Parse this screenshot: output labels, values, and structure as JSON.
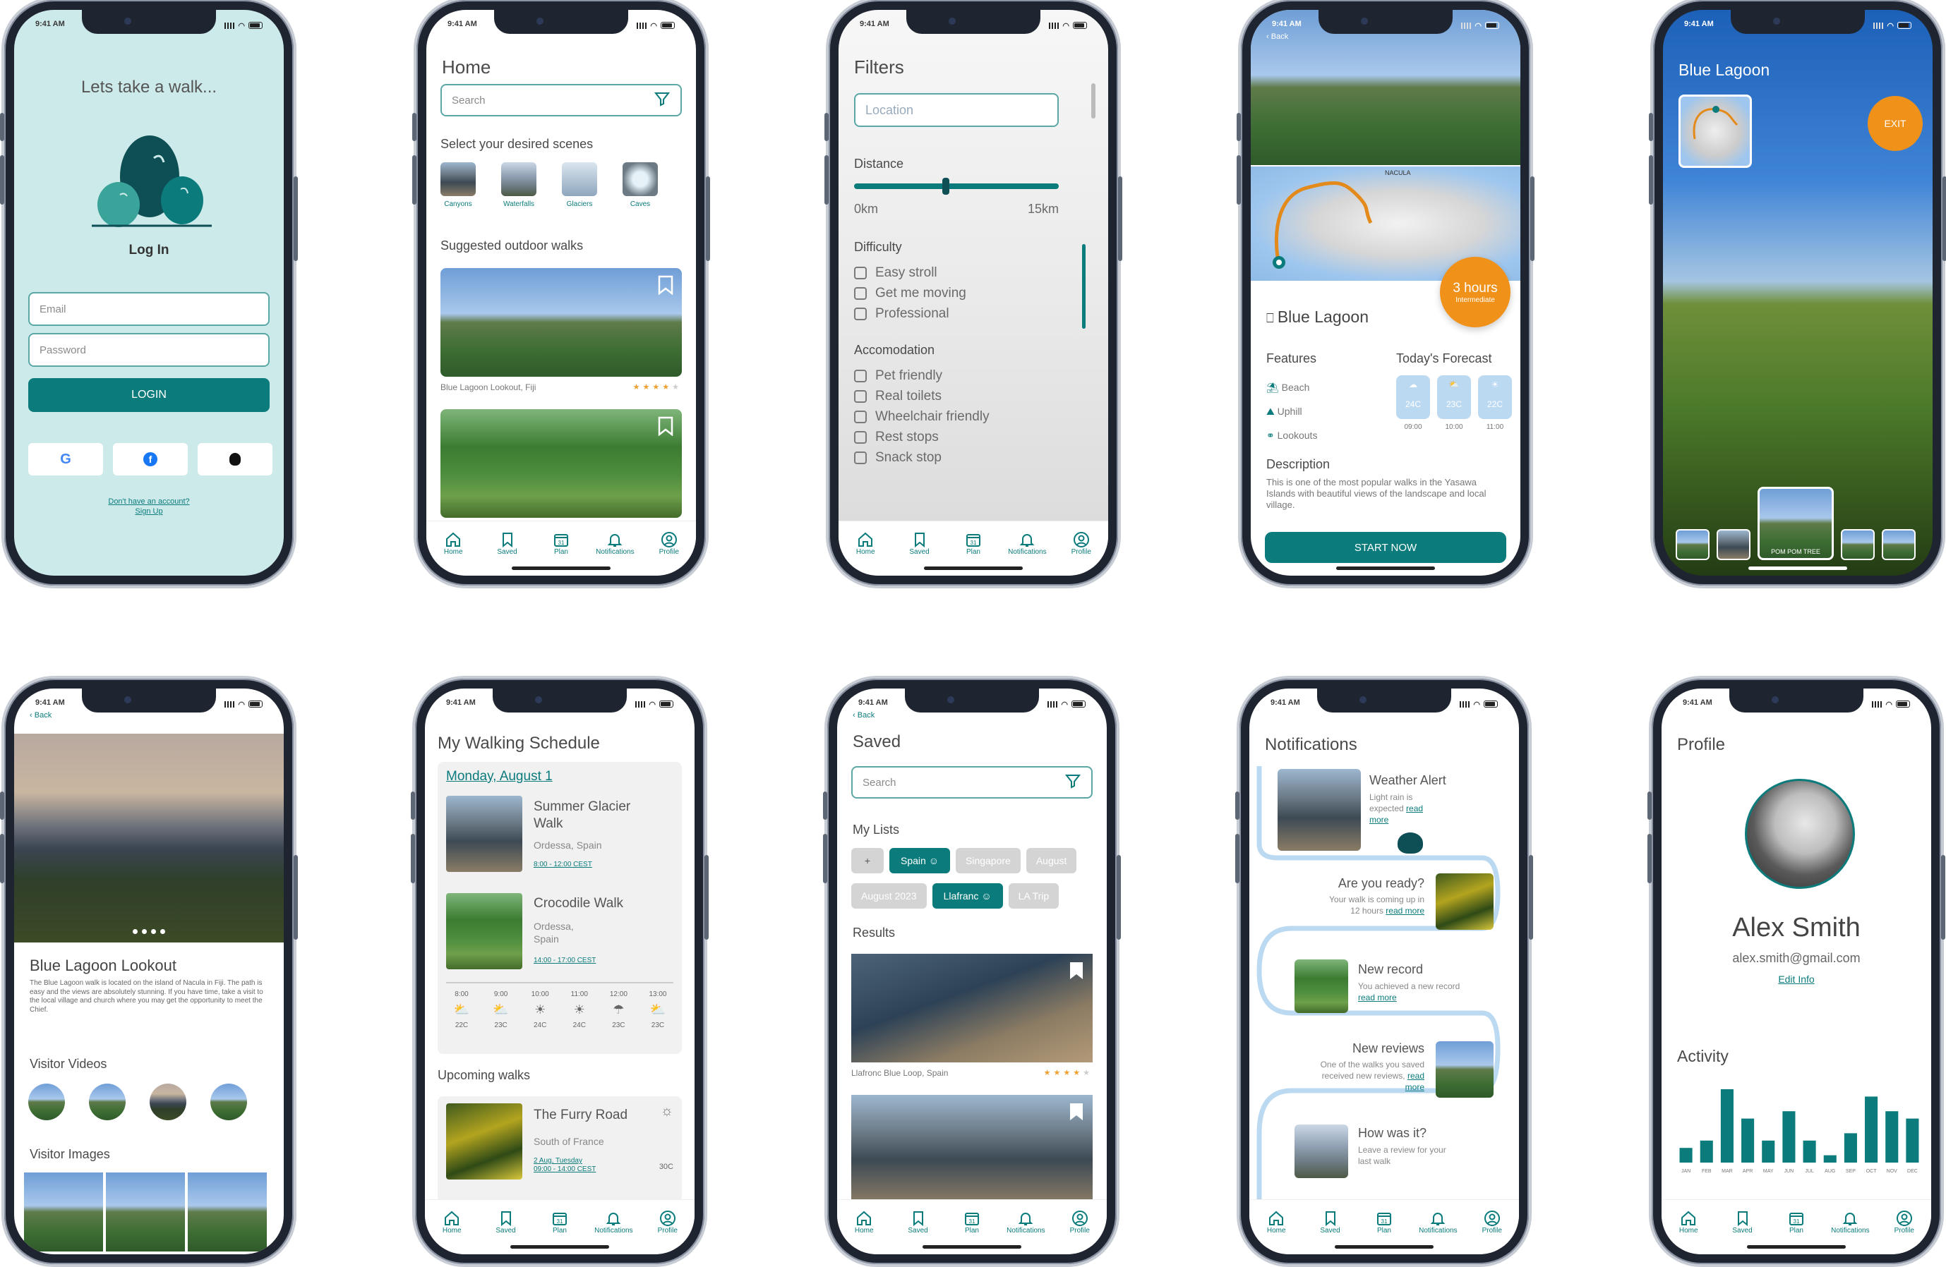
{
  "status": {
    "time": "9:41 AM"
  },
  "tabs": [
    "Home",
    "Saved",
    "Plan",
    "Notifications",
    "Profile"
  ],
  "plan_day": "31",
  "login": {
    "headline": "Lets take a walk...",
    "title": "Log In",
    "email_placeholder": "Email",
    "password_placeholder": "Password",
    "login_button": "LOGIN",
    "no_account": "Don't have an account?",
    "sign_up": "Sign Up"
  },
  "home": {
    "title": "Home",
    "search_placeholder": "Search",
    "scenes_heading": "Select your desired scenes",
    "scenes": [
      "Canyons",
      "Waterfalls",
      "Glaciers",
      "Caves"
    ],
    "suggested_heading": "Suggested outdoor walks",
    "walk_caption": "Blue Lagoon Lookout, Fiji",
    "rating": 4
  },
  "filters": {
    "title": "Filters",
    "location_placeholder": "Location",
    "distance_label": "Distance",
    "distance_min": "0km",
    "distance_max": "15km",
    "difficulty_label": "Difficulty",
    "difficulty": [
      "Easy stroll",
      "Get me moving",
      "Professional"
    ],
    "accommodation_label": "Accomodation",
    "accommodation": [
      "Pet friendly",
      "Real toilets",
      "Wheelchair friendly",
      "Rest stops",
      "Snack stop"
    ]
  },
  "detail": {
    "back": "Back",
    "map_label": "NACULA",
    "duration": "3 hours",
    "level": "Intermediate",
    "title": "Blue Lagoon",
    "features_label": "Features",
    "features": [
      "Beach",
      "Uphill",
      "Lookouts"
    ],
    "forecast_label": "Today's Forecast",
    "forecast": [
      {
        "temp": "24C",
        "time": "09:00"
      },
      {
        "temp": "23C",
        "time": "10:00"
      },
      {
        "temp": "22C",
        "time": "11:00"
      }
    ],
    "description_label": "Description",
    "description": "This is one of the most popular walks in the Yasawa Islands with beautiful views of the landscape and local village.",
    "start_button": "START NOW"
  },
  "camera": {
    "title": "Blue Lagoon",
    "exit": "EXIT",
    "poi_label": "POM POM TREE"
  },
  "lookout": {
    "back": "Back",
    "title": "Blue Lagoon Lookout",
    "body": "The Blue Lagoon walk is located on the island of Nacula in Fiji. The path is easy and the views are absolutely stunning. If you have time, take a visit to the local village and church where you may get the opportunity to meet the Chief.",
    "videos_label": "Visitor Videos",
    "images_label": "Visitor Images"
  },
  "schedule": {
    "title": "My Walking Schedule",
    "date": "Monday, August 1",
    "walks": [
      {
        "name": "Summer Glacier Walk",
        "place": "Ordessa, Spain",
        "time": "8:00 - 12:00 CEST"
      },
      {
        "name": "Crocodile Walk",
        "place": "Ordessa, Spain",
        "time": "14:00 - 17:00 CEST"
      }
    ],
    "hours": [
      "8:00",
      "9:00",
      "10:00",
      "11:00",
      "12:00",
      "13:00"
    ],
    "temps": [
      "22C",
      "23C",
      "24C",
      "24C",
      "23C",
      "23C"
    ],
    "upcoming_label": "Upcoming walks",
    "upcoming": {
      "name": "The Furry Road",
      "place": "South of France",
      "date": "2 Aug, Tuesday",
      "time": "09:00 - 14:00 CEST",
      "temp": "30C"
    }
  },
  "saved": {
    "back": "Back",
    "title": "Saved",
    "search_placeholder": "Search",
    "lists_label": "My Lists",
    "add": "+",
    "lists_row1": [
      "Spain",
      "Singapore",
      "August"
    ],
    "lists_row2": [
      "August 2023",
      "Llafranc",
      "LA Trip"
    ],
    "results_label": "Results",
    "result_caption": "Llafronc Blue Loop, Spain",
    "rating": 4
  },
  "notifications": {
    "title": "Notifications",
    "items": [
      {
        "title": "Weather Alert",
        "body": "Light rain is expected",
        "link": "read more"
      },
      {
        "title": "Are you ready?",
        "body": "Your walk is coming up in 12 hours",
        "link": "read more"
      },
      {
        "title": "New record",
        "body": "You achieved a new record",
        "link": "read more"
      },
      {
        "title": "New reviews",
        "body": "One of the walks you saved received new reviews,",
        "link": "read more"
      },
      {
        "title": "How was it?",
        "body": "Leave a review for your last walk",
        "link": ""
      }
    ]
  },
  "profile": {
    "title": "Profile",
    "name": "Alex Smith",
    "email": "alex.smith@gmail.com",
    "edit": "Edit Info",
    "activity_label": "Activity",
    "months": [
      "JAN",
      "FEB",
      "MAR",
      "APR",
      "MAY",
      "JUN",
      "JUL",
      "AUG",
      "SEP",
      "OCT",
      "NOV",
      "DEC"
    ],
    "activity": [
      2,
      3,
      10,
      6,
      3,
      7,
      3,
      1,
      4,
      9,
      7,
      6
    ]
  },
  "colors": {
    "teal": "#0b7b7c",
    "mint": "#cdeaea",
    "orange": "#f0921a",
    "light_blue": "#bcd9f2"
  }
}
